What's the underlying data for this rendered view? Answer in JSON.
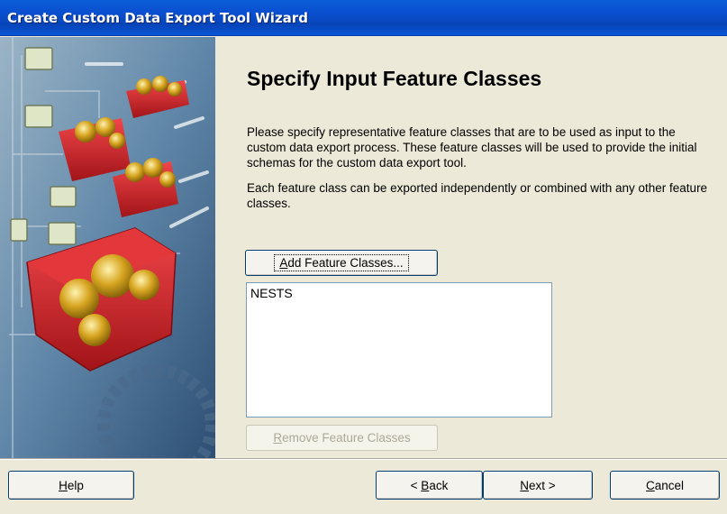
{
  "window": {
    "title": "Create Custom Data Export Tool Wizard"
  },
  "page": {
    "heading": "Specify Input Feature Classes",
    "description_1": "Please specify representative feature classes that are to be used as input to the custom data export process. These feature classes will be used to provide the initial schemas for the custom data export tool.",
    "description_2": "Each feature class can be exported independently or combined with any other feature classes."
  },
  "buttons": {
    "add_feature_classes": {
      "mnemonic": "A",
      "rest": "dd Feature Classes..."
    },
    "remove_feature_classes": {
      "mnemonic": "R",
      "rest": "emove Feature Classes",
      "enabled": false
    },
    "help": {
      "mnemonic": "H",
      "rest": "elp"
    },
    "back": {
      "prefix": "< ",
      "mnemonic": "B",
      "rest": "ack"
    },
    "next": {
      "mnemonic": "N",
      "rest": "ext >"
    },
    "cancel": {
      "mnemonic": "C",
      "rest": "ancel"
    }
  },
  "feature_classes": [
    "NESTS"
  ],
  "colors": {
    "titlebar": "#0a4fd0",
    "dialog_bg": "#ece9d8",
    "toolbox_red": "#d9262b"
  }
}
